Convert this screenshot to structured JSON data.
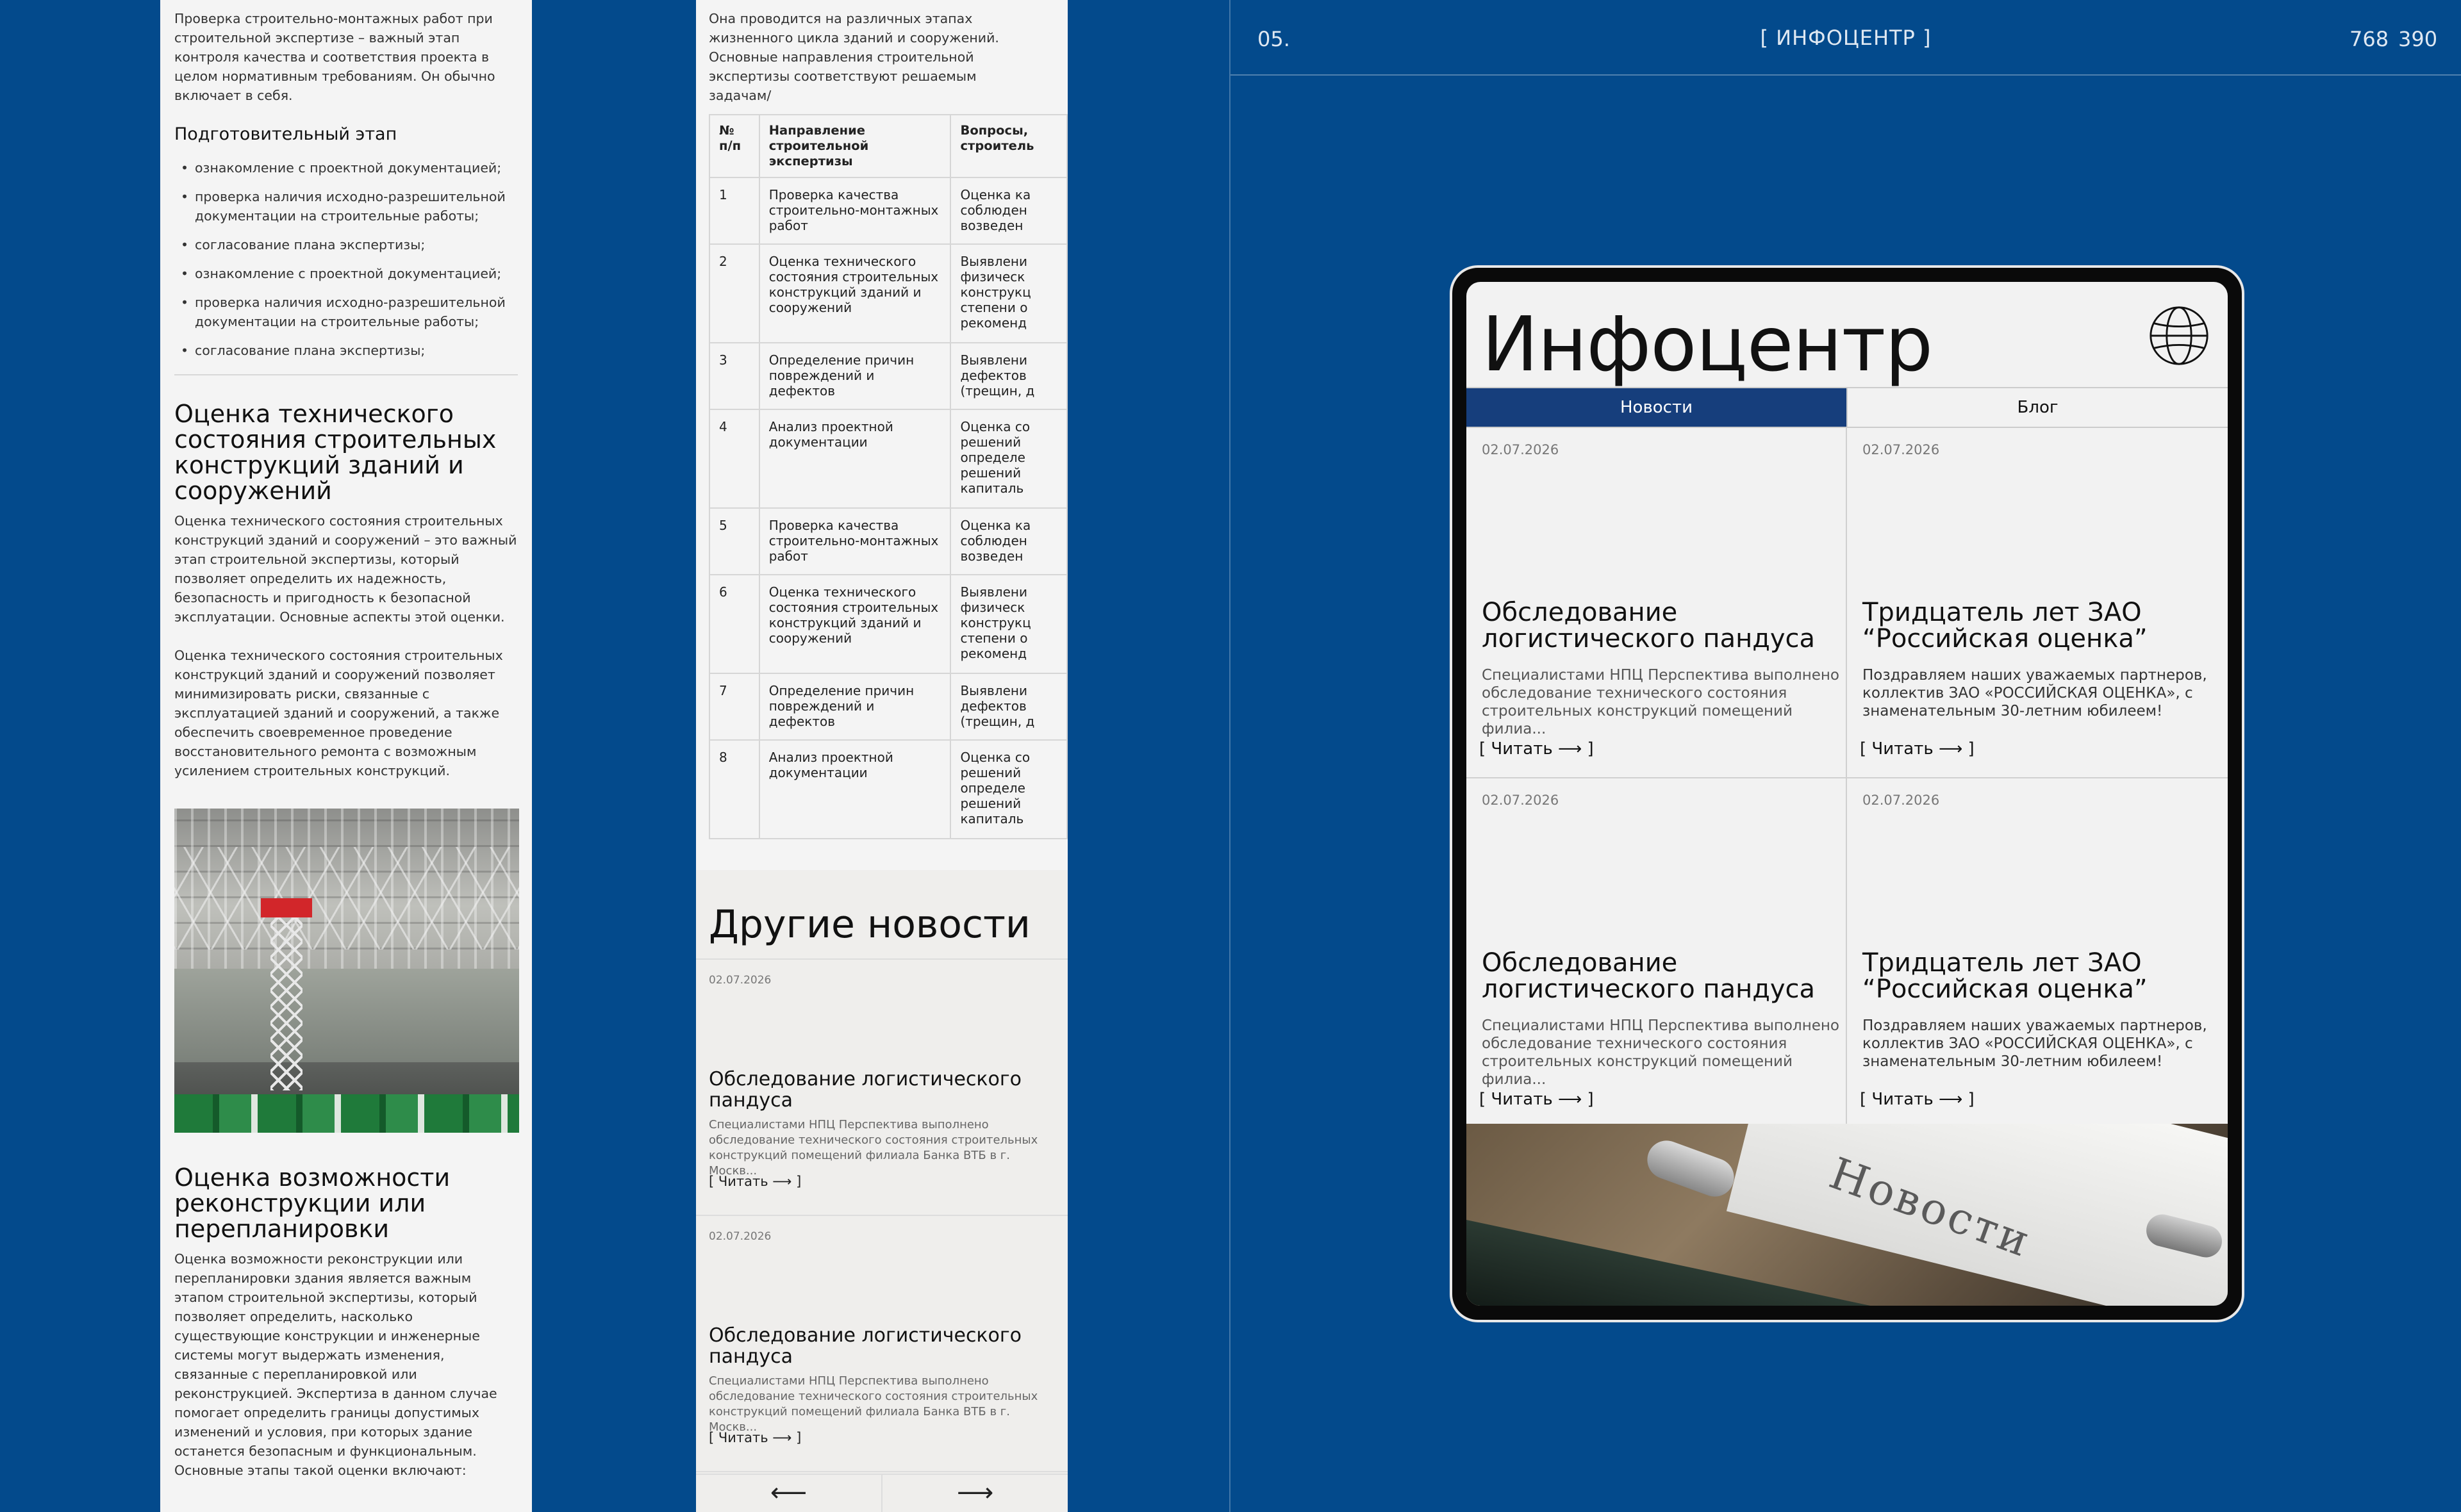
{
  "article": {
    "intro": "Проверка строительно-монтажных работ при строительной экспертизе – важный этап контроля качества и соответствия проекта в целом нормативным требованиям. Он обычно включает в себя.",
    "prep_title": "Подготовительный этап",
    "prep_items": [
      "ознакомление с проектной документацией;",
      "проверка наличия исходно-разрешительной документации на строительные работы;",
      "согласование плана экспертизы;",
      "ознакомление с проектной документацией;",
      "проверка наличия исходно-разрешительной документации на строительные работы;",
      "согласование плана экспертизы;"
    ],
    "sec1_title": "Оценка технического состояния строительных конструкций зданий и сооружений",
    "sec1_p1": "Оценка технического состояния строительных конструкций зданий и сооружений – это важный этап строительной экспертизы, который позволяет определить их надежность, безопасность и пригодность к безопасной эксплуатации. Основные аспекты этой оценки.",
    "sec1_p2": "Оценка технического состояния строительных конструкций зданий и сооружений позволяет минимизировать риски, связанные с эксплуатацией зданий и сооружений, а также обеспечить своевременное проведение восстановительного ремонта с возможным усилением строительных конструкций.",
    "sec2_title": "Оценка возможности реконструкции или перепланировки",
    "sec2_p1": "Оценка возможности реконструкции или перепланировки здания является важным этапом строительной экспертизы, который позволяет определить, насколько существующие конструкции и инженерные системы могут выдержать изменения, связанные с перепланировкой или реконструкцией. Экспертиза в данном случае помогает определить границы допустимых изменений и условия, при которых здание останется безопасным и функциональным. Основные этапы такой оценки включают:"
  },
  "table_panel": {
    "intro": "Она проводится на различных этапах жизненного цикла зданий и сооружений. Основные направления строительной экспертизы соответствуют решаемым задачам/",
    "headers": [
      "№ п/п",
      "Направление строительной экспертизы",
      "Вопросы, строитель"
    ],
    "rows": [
      [
        "1",
        "Проверка качества строительно-монтажных работ",
        "Оценка ка соблюден возведен"
      ],
      [
        "2",
        "Оценка технического состояния строительных конструкций зданий и сооружений",
        "Выявлени физическ конструкц степени о рекоменд"
      ],
      [
        "3",
        "Определение причин повреждений и дефектов",
        "Выявлени дефектов (трещин, д"
      ],
      [
        "4",
        "Анализ проектной документации",
        "Оценка со решений определе решений капиталь"
      ],
      [
        "5",
        "Проверка качества строительно-монтажных работ",
        "Оценка ка соблюден возведен"
      ],
      [
        "6",
        "Оценка технического состояния строительных конструкций зданий и сооружений",
        "Выявлени физическ конструкц степени о рекоменд"
      ],
      [
        "7",
        "Определение причин повреждений и дефектов",
        "Выявлени дефектов (трещин, д"
      ],
      [
        "8",
        "Анализ проектной документации",
        "Оценка со решений определе решений капиталь"
      ]
    ],
    "other_title": "Другие новости",
    "other_items": [
      {
        "date": "02.07.2026",
        "title": "Обследование логистического пандуса",
        "text": "Специалистами НПЦ Перспектива выполнено обследование технического состояния строительных конструкций помещений филиала Банка ВТБ в г. Москв...",
        "read": "[ Читать ⟶ ]"
      },
      {
        "date": "02.07.2026",
        "title": "Обследование логистического пандуса",
        "text": "Специалистами НПЦ Перспектива выполнено обследование технического состояния строительных конструкций помещений филиала Банка ВТБ в г. Москв...",
        "read": "[ Читать ⟶ ]"
      }
    ],
    "prev": "⟵",
    "next": "⟶"
  },
  "section": {
    "number": "05.",
    "title": "[ ИНФОЦЕНТР ]",
    "width": "768",
    "height": "390"
  },
  "tablet": {
    "title": "Инфоцентр",
    "tabs": [
      "Новости",
      "Блог"
    ],
    "cards": [
      {
        "date": "02.07.2026",
        "title": "Обследование логистического пандуса",
        "text": "Специалистами НПЦ Перспектива выполнено обследование технического состояния строительных конструкций помещений филиа...",
        "read": "[ Читать ⟶ ]"
      },
      {
        "date": "02.07.2026",
        "title": "Тридцатель лет ЗАО “Российская оценка”",
        "text": "Поздравляем наших уважаемых партнеров, коллектив ЗАО «РОССИЙСКАЯ ОЦЕНКА», с знаменательным 30-летним юбилеем!",
        "read": "[ Читать ⟶ ]"
      },
      {
        "date": "02.07.2026",
        "title": "Обследование логистического пандуса",
        "text": "Специалистами НПЦ Перспектива выполнено обследование технического состояния строительных конструкций помещений филиа...",
        "read": "[ Читать ⟶ ]"
      },
      {
        "date": "02.07.2026",
        "title": "Тридцатель лет ЗАО “Российская оценка”",
        "text": "Поздравляем наших уважаемых партнеров, коллектив ЗАО «РОССИЙСКАЯ ОЦЕНКА», с знаменательным 30-летним юбилеем!",
        "read": "[ Читать ⟶ ]"
      }
    ],
    "banner_word": "Новости"
  },
  "colors": {
    "background": "#034a8c",
    "panel": "#f4f4f4",
    "active_tab": "#163e7c"
  }
}
